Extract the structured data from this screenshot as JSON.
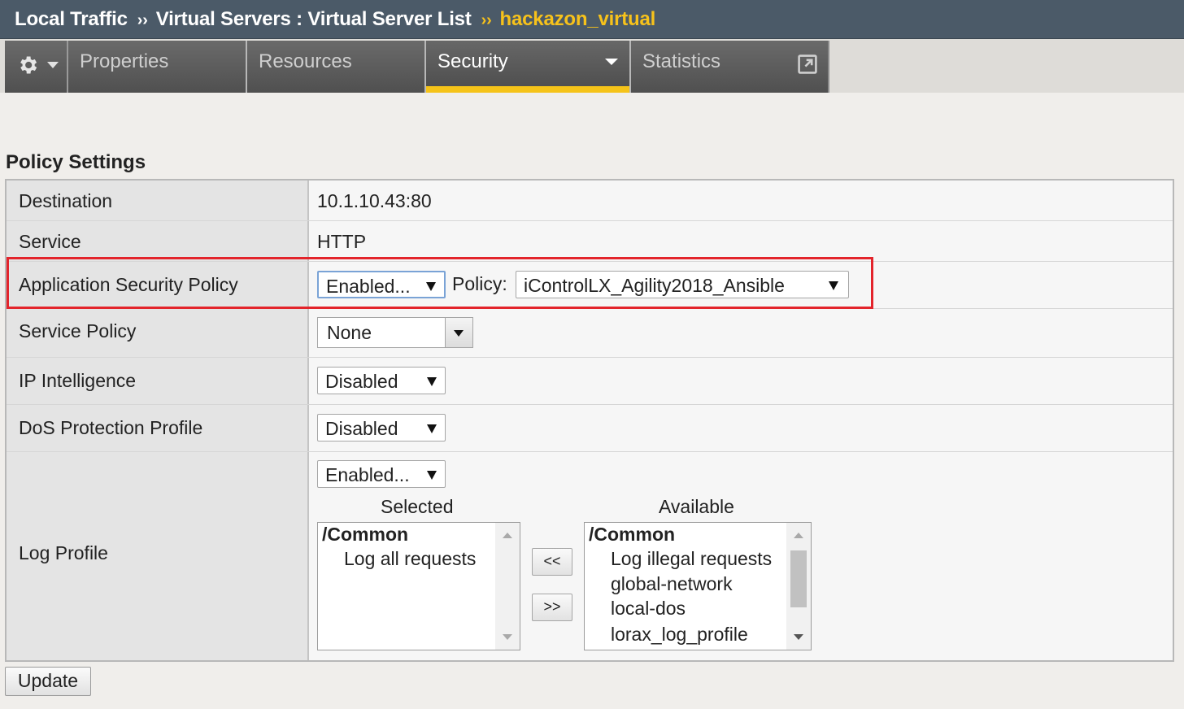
{
  "breadcrumb": {
    "item1": "Local Traffic",
    "separator": "››",
    "item2": "Virtual Servers : Virtual Server List",
    "current": "hackazon_virtual"
  },
  "tabs": {
    "gear_icon": "gear-icon",
    "properties": "Properties",
    "resources": "Resources",
    "security": "Security",
    "statistics": "Statistics",
    "active_tab_color": "#f5c319"
  },
  "section": {
    "title": "Policy Settings"
  },
  "rows": {
    "destination": {
      "label": "Destination",
      "value": "10.1.10.43:80"
    },
    "service": {
      "label": "Service",
      "value": "HTTP"
    },
    "app_security_policy": {
      "label": "Application Security Policy",
      "state": "Enabled...",
      "policy_label": "Policy:",
      "policy_value": "iControlLX_Agility2018_Ansible"
    },
    "service_policy": {
      "label": "Service Policy",
      "value": "None"
    },
    "ip_intelligence": {
      "label": "IP Intelligence",
      "value": "Disabled"
    },
    "dos_profile": {
      "label": "DoS Protection Profile",
      "value": "Disabled"
    },
    "log_profile": {
      "label": "Log Profile",
      "state": "Enabled...",
      "selected_header": "Selected",
      "available_header": "Available",
      "selected_group": "/Common",
      "selected_items": [
        "Log all requests"
      ],
      "available_group": "/Common",
      "available_items": [
        "Log illegal requests",
        "global-network",
        "local-dos",
        "lorax_log_profile"
      ],
      "move_left": "<<",
      "move_right": ">>"
    }
  },
  "update_button": "Update",
  "highlight_color": "#e3242b"
}
